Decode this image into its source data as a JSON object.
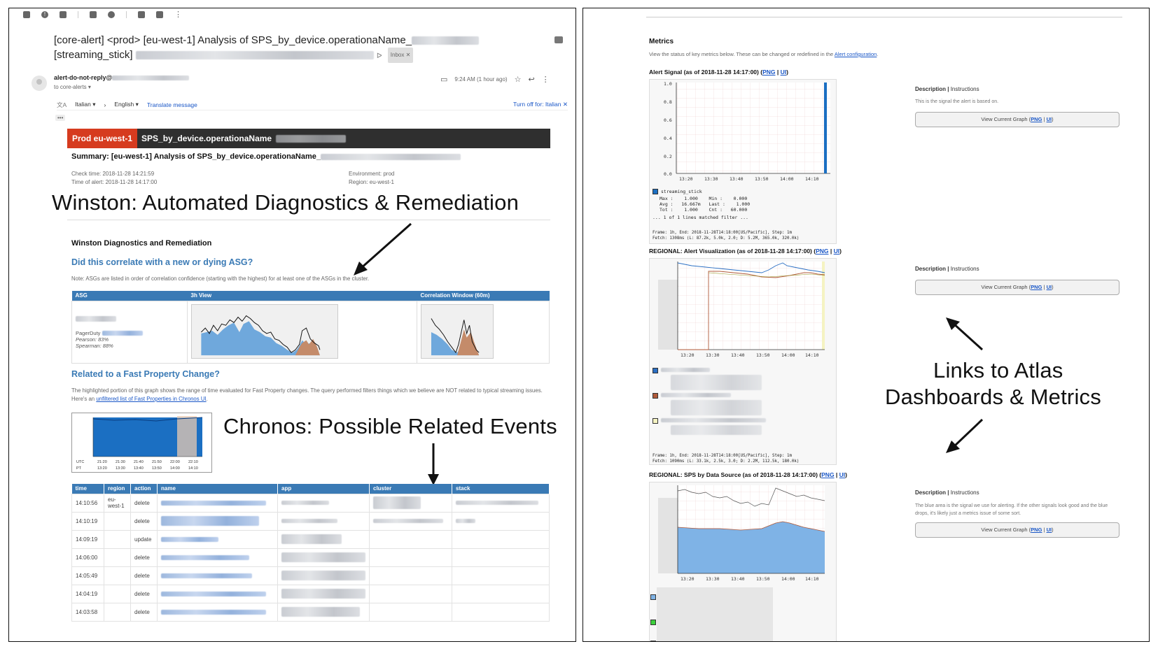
{
  "email": {
    "subject_prefix": "[core-alert] <prod> [eu-west-1] Analysis of SPS_by_device.operationaName_",
    "subject_line2": "[streaming_stick]",
    "inbox_label": "Inbox",
    "sender": "alert-do-not-reply@",
    "to": "to core-alerts",
    "time": "9:24 AM (1 hour ago)",
    "translate": {
      "from_lang": "Italian",
      "to_lang": "English",
      "translate_link": "Translate message",
      "turn_off": "Turn off for: Italian"
    }
  },
  "alert": {
    "prod_tag": "Prod eu-west-1",
    "metric": "SPS_by_device.operationaName",
    "summary": "Summary: [eu-west-1] Analysis of SPS_by_device.operationaName_",
    "check_time": "Check time: 2018-11-28 14:21:59",
    "alert_time": "Time of alert: 2018-11-28 14:17:00",
    "environment": "Environment: prod",
    "region": "Region: eu-west-1"
  },
  "overlays": {
    "winston": "Winston: Automated Diagnostics & Remediation",
    "chronos": "Chronos: Possible Related Events",
    "links_line1": "Links to Atlas",
    "links_line2": "Dashboards & Metrics"
  },
  "diagnostics": {
    "section_title": "Winston Diagnostics and Remediation",
    "asg_question": "Did this correlate with a new or dying ASG?",
    "asg_note": "Note: ASGs are listed in order of correlation confidence (starting with the highest) for at least one of the ASGs in the cluster.",
    "asg_headers": [
      "ASG",
      "3h View",
      "Correlation Window (60m)"
    ],
    "pagerduty": "PagerDuty",
    "pearson": "Pearson: 83%",
    "spearman": "Spearman: 88%",
    "fp_question": "Related to a Fast Property Change?",
    "fp_note": "The highlighted portion of this graph shows the range of time evaluated for Fast Property changes. The query performed filters things which we believe are NOT related to typical streaming issues. Here's an",
    "fp_link": "unfiltered list of Fast Properties in Chronos UI",
    "fp_axis_utc": [
      "UTC",
      "21:20",
      "21:30",
      "21:40",
      "21:50",
      "22:00",
      "22:10"
    ],
    "fp_axis_pt": [
      "PT",
      "13:20",
      "13:30",
      "13:40",
      "13:50",
      "14:00",
      "14:10"
    ]
  },
  "events": {
    "headers": [
      "time",
      "region",
      "action",
      "name",
      "app",
      "cluster",
      "stack"
    ],
    "rows": [
      {
        "time": "14:10:56",
        "region": "eu-west-1",
        "action": "delete"
      },
      {
        "time": "14:10:19",
        "region": "",
        "action": "delete"
      },
      {
        "time": "14:09:19",
        "region": "",
        "action": "update"
      },
      {
        "time": "14:06:00",
        "region": "",
        "action": "delete"
      },
      {
        "time": "14:05:49",
        "region": "",
        "action": "delete"
      },
      {
        "time": "14:04:19",
        "region": "",
        "action": "delete"
      },
      {
        "time": "14:03:58",
        "region": "",
        "action": "delete"
      }
    ]
  },
  "metrics": {
    "title": "Metrics",
    "subtitle": "View the status of key metrics below. These can be changed or redefined in the",
    "subtitle_link": "Alert configuration",
    "png": "PNG",
    "ui": "UI",
    "view_graph": "View Current Graph",
    "desc_label": "Description",
    "instr_label": "Instructions",
    "graphs": [
      {
        "title": "Alert Signal (as of 2018-11-28 14:17:00)",
        "desc_text": "This is the signal the alert is based on.",
        "yticks": [
          "1.0",
          "0.8",
          "0.6",
          "0.4",
          "0.2",
          "0.0"
        ],
        "xticks": [
          "13:20",
          "13:30",
          "13:40",
          "13:50",
          "14:00",
          "14:10"
        ],
        "legend_name": "streaming_stick",
        "stats": "Max :    1.000    Min :    0.000\nAvg :   16.667m   Last :    1.000\nTot :    1.000    Cnt :   60.000",
        "matched": "... 1 of 1 lines matched filter ...",
        "footer": "Frame: 1h, End: 2018-11-28T14:18:00[US/Pacific], Step: 1m\nFetch: 1308ms (L: 87.2k, 5.0k, 2.0; D: 5.2M, 365.0k, 320.0k)"
      },
      {
        "title": "REGIONAL: Alert Visualization (as of 2018-11-28 14:17:00)",
        "desc_text": "",
        "xticks": [
          "13:20",
          "13:30",
          "13:40",
          "13:50",
          "14:00",
          "14:10"
        ],
        "footer": "Frame: 1h, End: 2018-11-28T14:18:00[US/Pacific], Step: 1m\nFetch: 1090ms (L: 33.1k, 2.5k, 3.0; D: 2.2M, 112.5k, 180.0k)"
      },
      {
        "title": "REGIONAL: SPS by Data Source (as of 2018-11-28 14:17:00)",
        "desc_text": "The blue area is the signal we use for alerting. If the other signals look good and the blue drops, it's likely just a metrics issue of some sort.",
        "xticks": [
          "13:20",
          "13:30",
          "13:40",
          "13:50",
          "14:00",
          "14:10"
        ]
      }
    ]
  },
  "colors": {
    "table_header": "#3a7ab5",
    "prod_red": "#d63b1f",
    "alert_bar": "#2f2f2f",
    "link_blue": "#1a57c7",
    "signal_blue": "#1b6fc2"
  }
}
